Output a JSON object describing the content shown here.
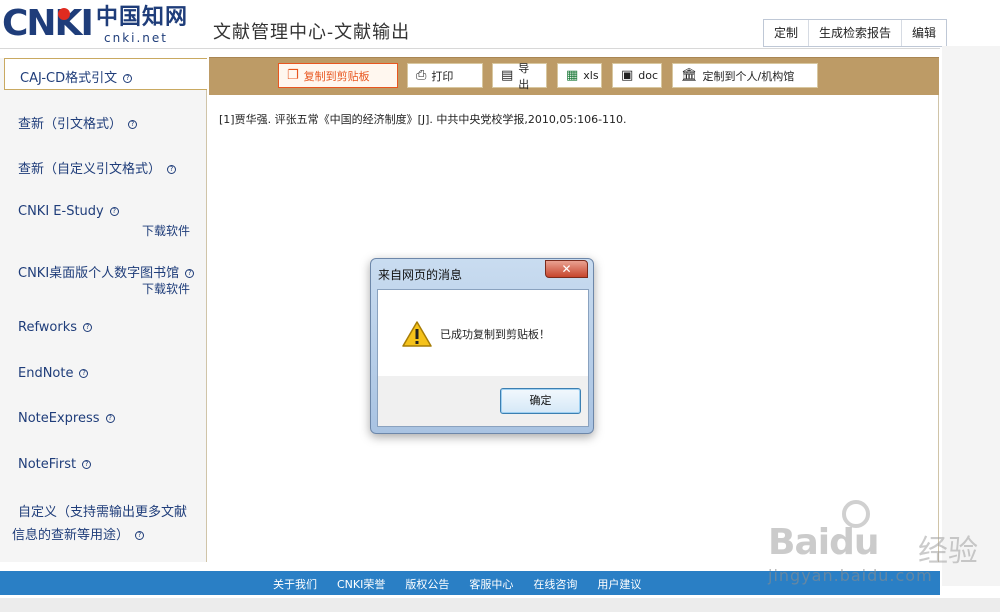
{
  "header": {
    "logo_cnki": "CNKI",
    "logo_cn": "中国知网",
    "logo_net": "cnki.net",
    "page_title": "文献管理中心-文献输出",
    "actions": [
      "定制",
      "生成检索报告",
      "编辑"
    ]
  },
  "sidebar": {
    "active": "CAJ-CD格式引文",
    "items": [
      {
        "label": "查新（引文格式）"
      },
      {
        "label": "查新（自定义引文格式）"
      },
      {
        "label": "CNKI E-Study",
        "sub": "下载软件"
      },
      {
        "label": "CNKI桌面版个人数字图书馆",
        "sub": "下载软件"
      },
      {
        "label": "Refworks"
      },
      {
        "label": "EndNote"
      },
      {
        "label": "NoteExpress"
      },
      {
        "label": "NoteFirst"
      },
      {
        "label": "自定义（支持需输出更多文献",
        "label2": "信息的查新等用途）"
      }
    ],
    "help_glyph": "?"
  },
  "toolbar": {
    "copy": "复制到剪贴板",
    "print": "打印",
    "export": "导出",
    "xls": "xls",
    "doc": "doc",
    "custom": "定制到个人/机构馆"
  },
  "content": {
    "citation": "[1]贾华强. 评张五常《中国的经济制度》[J]. 中共中央党校学报,2010,05:106-110."
  },
  "dialog": {
    "title": "来自网页的消息",
    "close": "✕",
    "message": "已成功复制到剪贴板！",
    "ok": "确定"
  },
  "footer": {
    "links": [
      "关于我们",
      "CNKI荣誉",
      "版权公告",
      "客服中心",
      "在线咨询",
      "用户建议"
    ]
  },
  "watermark": {
    "bai": "Bai",
    "du": "du",
    "jingyan": "经验",
    "url": "jingyan.baidu.com"
  },
  "colors": {
    "brand_blue": "#1f3d7a",
    "toolbar_tan": "#bd9b66",
    "copy_accent": "#e8561f",
    "footer_blue": "#2a7fc5"
  }
}
